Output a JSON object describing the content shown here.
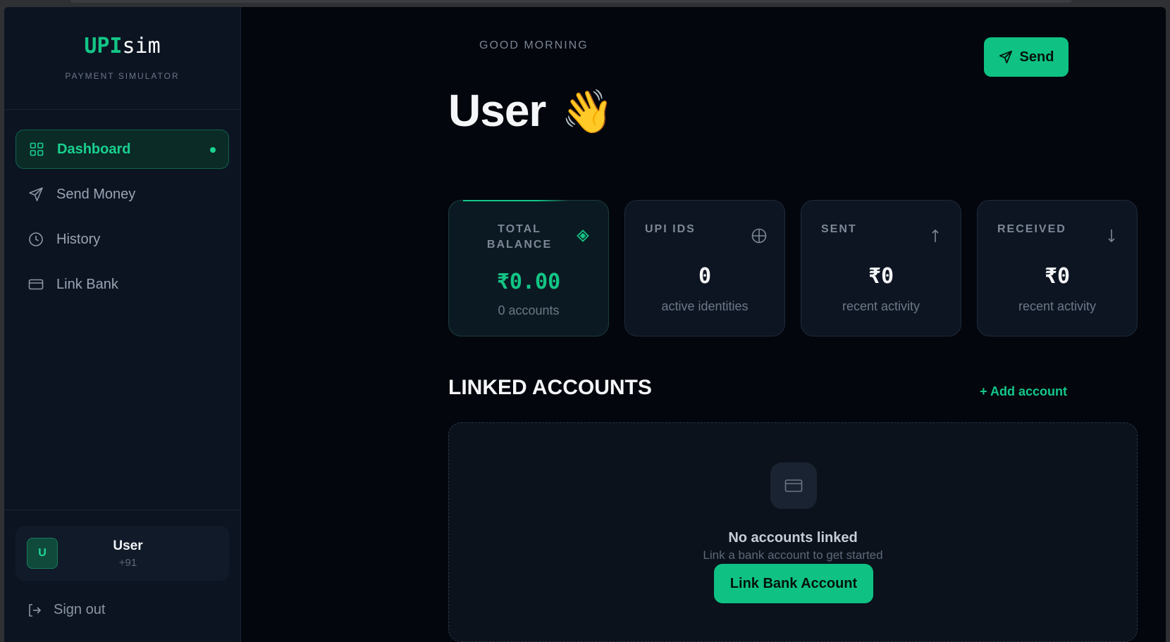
{
  "brand": {
    "logo_accent": "UPI",
    "logo_rest": "sim",
    "tagline": "PAYMENT SIMULATOR"
  },
  "sidebar": {
    "items": [
      {
        "label": "Dashboard",
        "icon": "grid-icon",
        "active": true
      },
      {
        "label": "Send Money",
        "icon": "send-icon",
        "active": false
      },
      {
        "label": "History",
        "icon": "clock-icon",
        "active": false
      },
      {
        "label": "Link Bank",
        "icon": "card-icon",
        "active": false
      }
    ]
  },
  "user": {
    "initial": "U",
    "name": "User",
    "phone": "+91"
  },
  "signout_label": "Sign out",
  "header": {
    "greeting": "GOOD MORNING",
    "name": "User",
    "wave_emoji": "👋",
    "send_label": "Send"
  },
  "stats": [
    {
      "label": "TOTAL BALANCE",
      "value": "₹0.00",
      "sub": "0 accounts",
      "icon": "diamond-icon"
    },
    {
      "label": "UPI IDS",
      "value": "0",
      "sub": "active identities",
      "icon": "globe-icon"
    },
    {
      "label": "SENT",
      "value": "₹0",
      "sub": "recent activity",
      "icon": "arrow-up-icon"
    },
    {
      "label": "RECEIVED",
      "value": "₹0",
      "sub": "recent activity",
      "icon": "arrow-down-icon"
    }
  ],
  "linked_accounts": {
    "title": "LINKED ACCOUNTS",
    "add_label": "+ Add account",
    "empty_title": "No accounts linked",
    "empty_sub": "Link a bank account to get started",
    "link_button": "Link Bank Account"
  },
  "colors": {
    "accent": "#13c585",
    "background": "#03060d",
    "sidebar": "#0c1422"
  }
}
